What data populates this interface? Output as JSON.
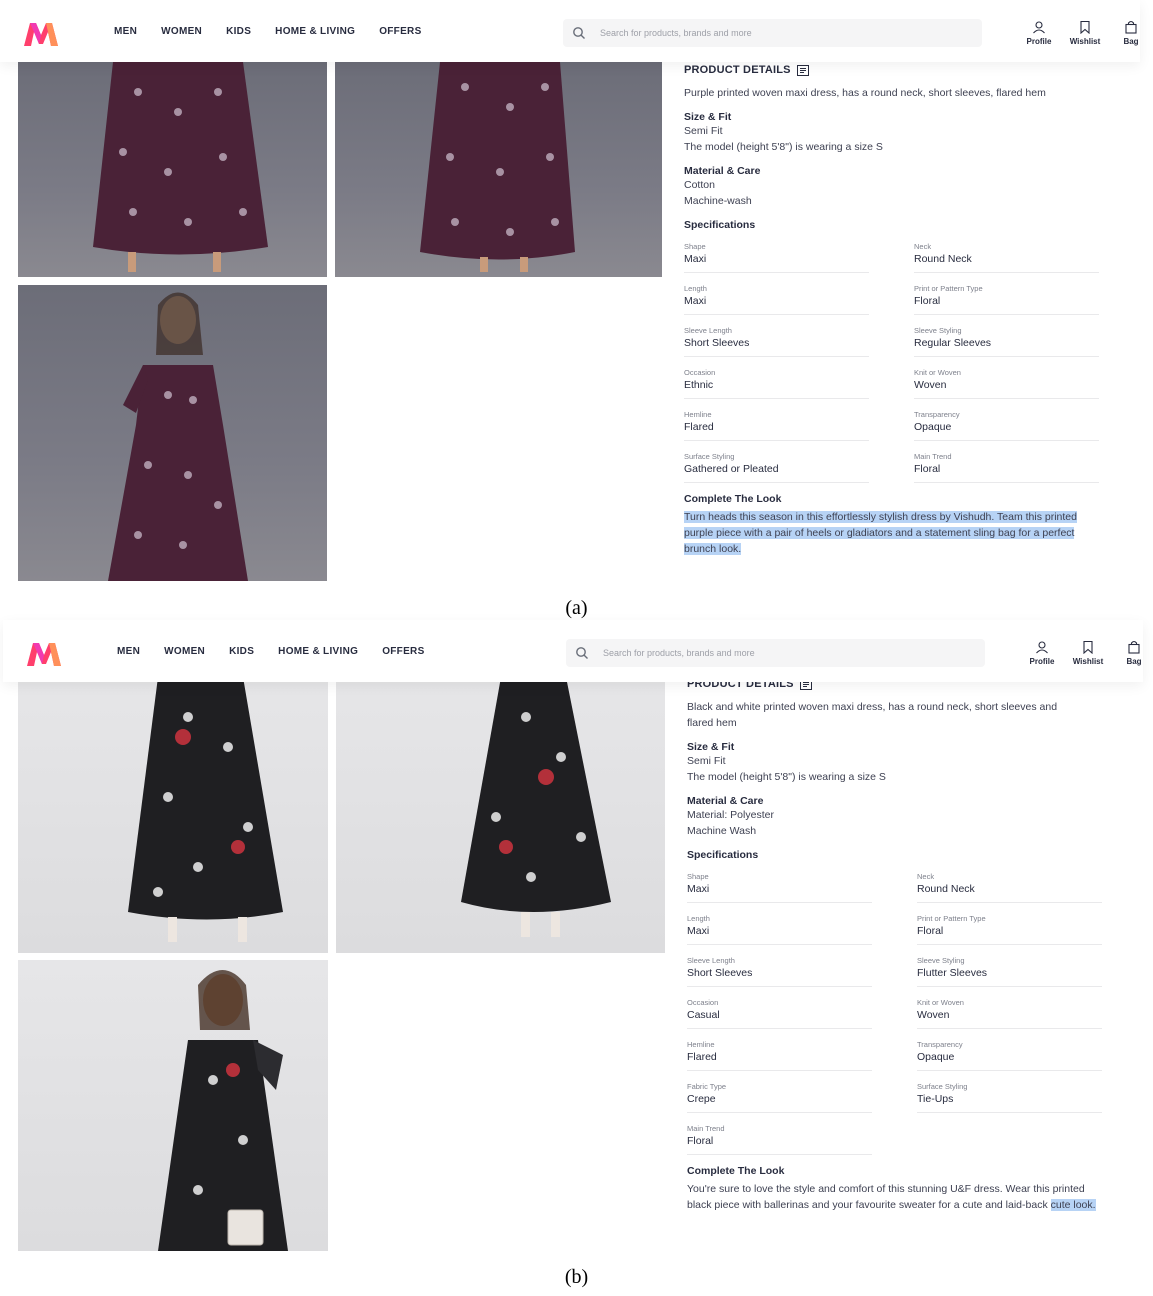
{
  "header": {
    "nav": [
      "MEN",
      "WOMEN",
      "KIDS",
      "HOME & LIVING",
      "OFFERS"
    ],
    "search_placeholder": "Search for products, brands and more",
    "icons": [
      {
        "label": "Profile",
        "icon": "profile-icon"
      },
      {
        "label": "Wishlist",
        "icon": "bookmark-icon"
      },
      {
        "label": "Bag",
        "icon": "bag-icon"
      }
    ],
    "logo_colors": [
      "#ff3f6c",
      "#f13ab1",
      "#ff905a"
    ]
  },
  "panel_a": {
    "caption": "(a)",
    "product_details_title": "PRODUCT DETAILS",
    "description": "Purple printed woven maxi dress, has a round neck, short sleeves, flared hem",
    "size_fit_title": "Size & Fit",
    "size_fit": [
      "Semi Fit",
      "The model (height 5'8\") is wearing a size S"
    ],
    "material_title": "Material & Care",
    "material": [
      "Cotton",
      "Machine-wash"
    ],
    "specs_title": "Specifications",
    "specs": [
      {
        "k": "Shape",
        "v": "Maxi"
      },
      {
        "k": "Neck",
        "v": "Round Neck"
      },
      {
        "k": "Length",
        "v": "Maxi"
      },
      {
        "k": "Print or Pattern Type",
        "v": "Floral"
      },
      {
        "k": "Sleeve Length",
        "v": "Short Sleeves"
      },
      {
        "k": "Sleeve Styling",
        "v": "Regular Sleeves"
      },
      {
        "k": "Occasion",
        "v": "Ethnic"
      },
      {
        "k": "Knit or Woven",
        "v": "Woven"
      },
      {
        "k": "Hemline",
        "v": "Flared"
      },
      {
        "k": "Transparency",
        "v": "Opaque"
      },
      {
        "k": "Surface Styling",
        "v": "Gathered or Pleated"
      },
      {
        "k": "Main Trend",
        "v": "Floral"
      }
    ],
    "look_title": "Complete The Look",
    "look_text": "Turn heads this season in this effortlessly stylish dress by Vishudh. Team this printed purple piece with a pair of heels or gladiators and a statement sling bag for a perfect brunch look.",
    "dress_color": "#4a2237"
  },
  "panel_b": {
    "caption": "(b)",
    "product_details_title": "PRODUCT DETAILS",
    "description": "Black and white printed woven maxi dress, has a round neck, short sleeves and flared hem",
    "size_fit_title": "Size & Fit",
    "size_fit": [
      "Semi Fit",
      "The model (height 5'8\") is wearing a size S"
    ],
    "material_title": "Material & Care",
    "material": [
      "Material: Polyester",
      "Machine Wash"
    ],
    "specs_title": "Specifications",
    "specs": [
      {
        "k": "Shape",
        "v": "Maxi"
      },
      {
        "k": "Neck",
        "v": "Round Neck"
      },
      {
        "k": "Length",
        "v": "Maxi"
      },
      {
        "k": "Print or Pattern Type",
        "v": "Floral"
      },
      {
        "k": "Sleeve Length",
        "v": "Short Sleeves"
      },
      {
        "k": "Sleeve Styling",
        "v": "Flutter Sleeves"
      },
      {
        "k": "Occasion",
        "v": "Casual"
      },
      {
        "k": "Knit or Woven",
        "v": "Woven"
      },
      {
        "k": "Hemline",
        "v": "Flared"
      },
      {
        "k": "Transparency",
        "v": "Opaque"
      },
      {
        "k": "Fabric Type",
        "v": "Crepe"
      },
      {
        "k": "Surface Styling",
        "v": "Tie-Ups"
      },
      {
        "k": "Main Trend",
        "v": "Floral"
      }
    ],
    "look_title": "Complete The Look",
    "look_text_plain": "You're sure to love the style and comfort of this stunning U&F dress. Wear this printed black piece with ballerinas and your favourite sweater for a cute and laid-back ",
    "look_text_highlight": "cute look.",
    "dress_color": "#1f1f22"
  }
}
